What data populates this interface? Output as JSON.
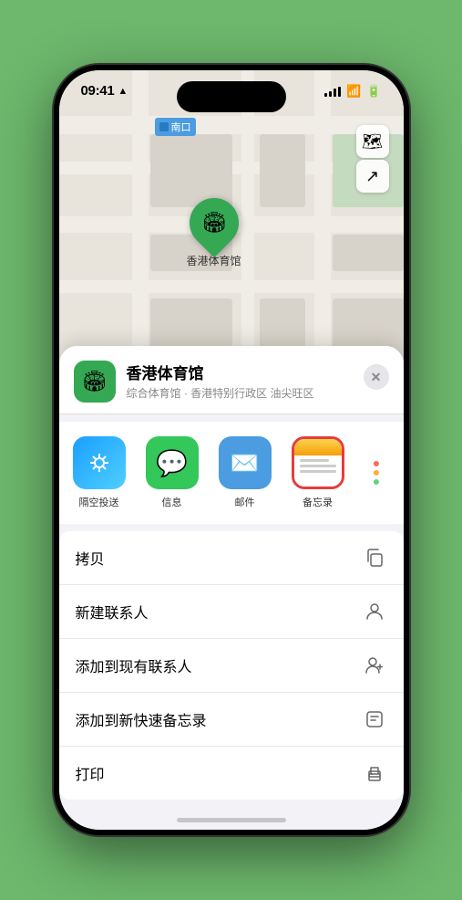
{
  "statusBar": {
    "time": "09:41",
    "timeIcon": "location-arrow-icon"
  },
  "map": {
    "label": "南口",
    "pinLabel": "香港体育馆",
    "controls": {
      "mapTypeIcon": "🗺",
      "locationIcon": "↗"
    }
  },
  "bottomSheet": {
    "venueName": "香港体育馆",
    "venueSubtitle": "综合体育馆 · 香港特别行政区 油尖旺区",
    "closeLabel": "✕",
    "shareItems": [
      {
        "label": "隔空投送",
        "type": "airdrop"
      },
      {
        "label": "信息",
        "type": "message"
      },
      {
        "label": "邮件",
        "type": "mail"
      },
      {
        "label": "备忘录",
        "type": "notes",
        "selected": true
      }
    ],
    "actions": [
      {
        "label": "拷贝",
        "icon": "copy"
      },
      {
        "label": "新建联系人",
        "icon": "person"
      },
      {
        "label": "添加到现有联系人",
        "icon": "person-add"
      },
      {
        "label": "添加到新快速备忘录",
        "icon": "note"
      },
      {
        "label": "打印",
        "icon": "printer"
      }
    ]
  }
}
